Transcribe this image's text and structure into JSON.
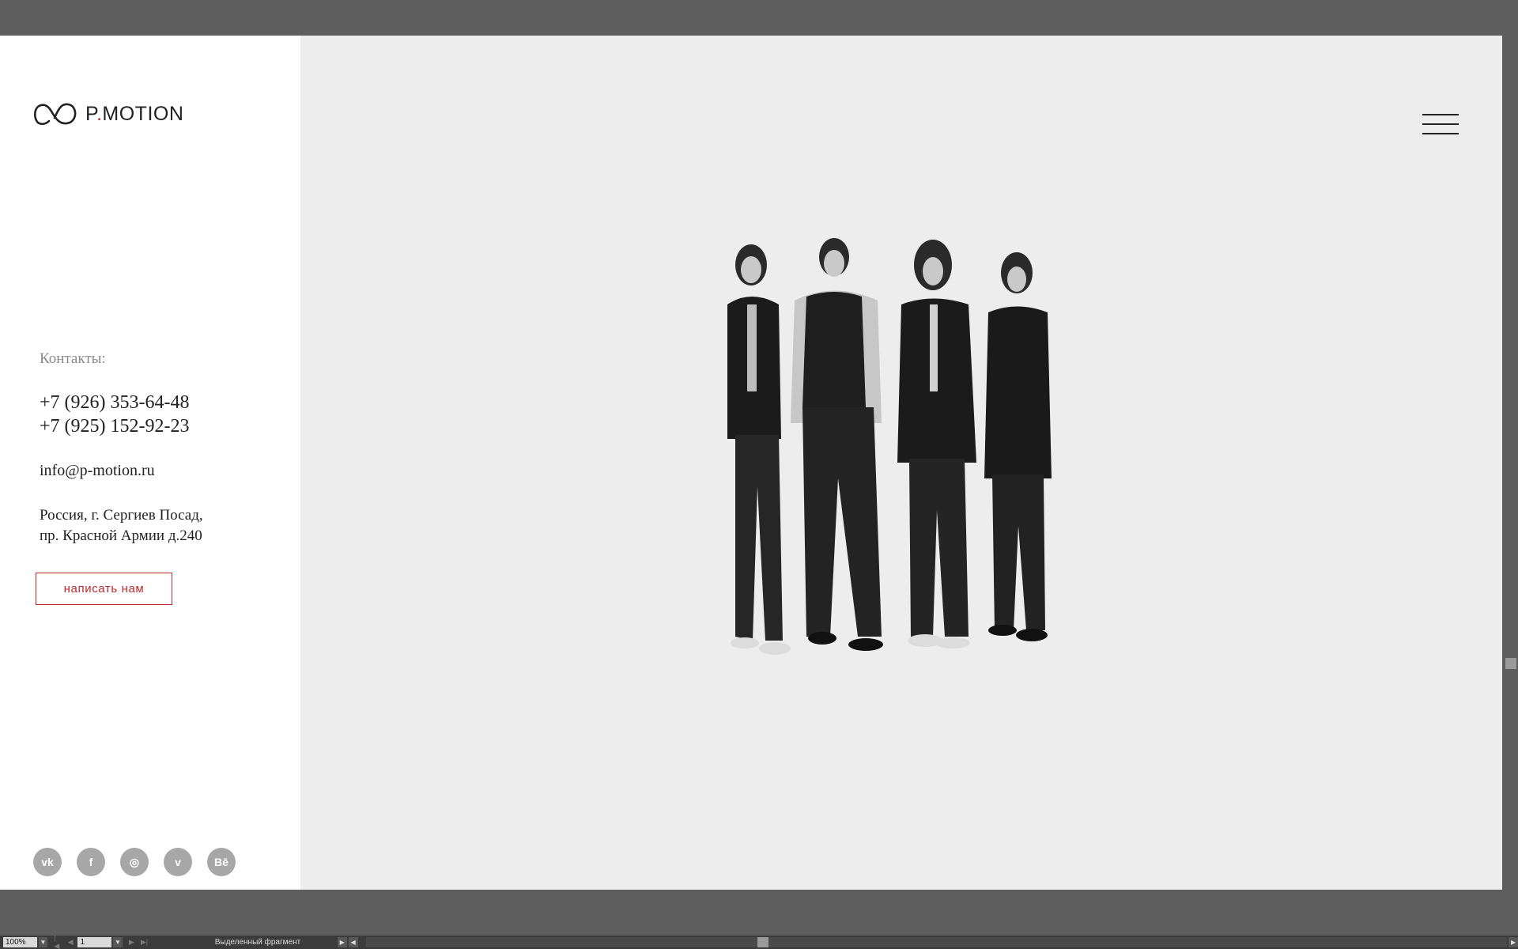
{
  "brand": {
    "name_prefix": "P",
    "name_dot": ".",
    "name_suffix": "MOTION"
  },
  "contacts": {
    "label": "Контакты:",
    "phones": [
      "+7 (926) 353-64-48",
      "+7 (925) 152-92-23"
    ],
    "email": "info@p-motion.ru",
    "address_line1": "Россия, г. Сергиев Посад,",
    "address_line2": "пр. Красной Армии д.240",
    "write_button": "написать нам"
  },
  "social": [
    {
      "name": "vk",
      "glyph": "vk"
    },
    {
      "name": "facebook",
      "glyph": "f"
    },
    {
      "name": "instagram",
      "glyph": "◎"
    },
    {
      "name": "vimeo",
      "glyph": "v"
    },
    {
      "name": "behance",
      "glyph": "Bē"
    }
  ],
  "statusbar": {
    "zoom": "100%",
    "page": "1",
    "status_text": "Выделенный фрагмент"
  },
  "colors": {
    "accent": "#c0292b",
    "sidebar_bg": "#ffffff",
    "main_bg": "#ededed",
    "chrome_bg": "#5e5e5e"
  }
}
